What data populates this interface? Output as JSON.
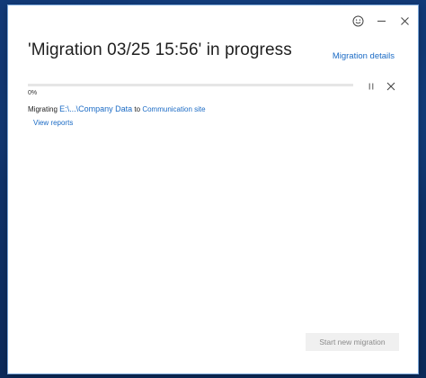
{
  "header": {
    "title": "'Migration 03/25 15:56' in progress",
    "details_link": "Migration details"
  },
  "progress": {
    "percent_text": "0%",
    "value": 0
  },
  "migration": {
    "prefix": "Migrating",
    "source": "E:\\...\\Company Data",
    "connector": "to",
    "destination": "Communication site"
  },
  "links": {
    "view_reports": "View reports"
  },
  "footer": {
    "start_new_label": "Start new migration"
  },
  "icons": {
    "feedback": "smiley-icon",
    "minimize": "minimize-icon",
    "close": "close-icon",
    "pause": "pause-icon",
    "cancel": "close-icon"
  },
  "colors": {
    "accent": "#1b6bc5",
    "title_text": "#1f1f1f",
    "disabled_button_bg": "#f0f0f0",
    "desktop_bg": "#0f2f63"
  }
}
